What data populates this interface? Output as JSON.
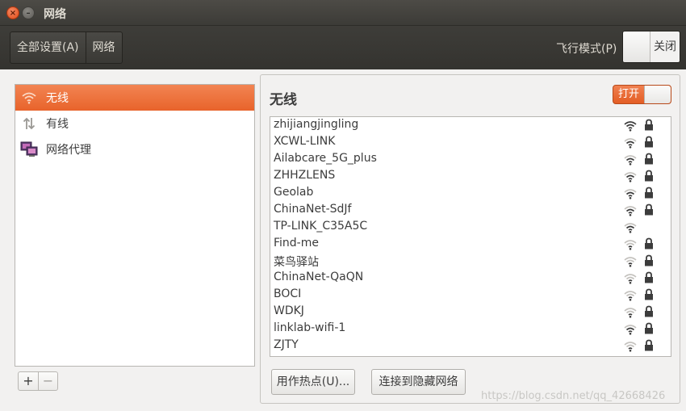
{
  "window": {
    "title": "网络"
  },
  "toolbar": {
    "crumbs": [
      "全部设置(A)",
      "网络"
    ],
    "airplane_label": "飞行模式(P)",
    "airplane_state": "关闭"
  },
  "devices": [
    {
      "label": "无线",
      "icon": "wifi-icon",
      "selected": true
    },
    {
      "label": "有线",
      "icon": "wired-arrows-icon",
      "selected": false
    },
    {
      "label": "网络代理",
      "icon": "proxy-monitor-icon",
      "selected": false
    }
  ],
  "list_tools": {
    "add": "+",
    "remove": "−"
  },
  "wireless": {
    "title": "无线",
    "switch_label": "打开",
    "networks": [
      {
        "name": "zhijiangjingling",
        "secured": true,
        "strength": 4
      },
      {
        "name": "XCWL-LINK",
        "secured": true,
        "strength": 3
      },
      {
        "name": "Ailabcare_5G_plus",
        "secured": true,
        "strength": 3
      },
      {
        "name": "ZHHZLENS",
        "secured": true,
        "strength": 3
      },
      {
        "name": "Geolab",
        "secured": true,
        "strength": 3
      },
      {
        "name": "ChinaNet-SdJf",
        "secured": true,
        "strength": 3
      },
      {
        "name": "TP-LINK_C35A5C",
        "secured": false,
        "strength": 3
      },
      {
        "name": "Find-me",
        "secured": true,
        "strength": 2
      },
      {
        "name": "菜鸟驿站",
        "secured": true,
        "strength": 2
      },
      {
        "name": "ChinaNet-QaQN",
        "secured": true,
        "strength": 2
      },
      {
        "name": "BOCI",
        "secured": true,
        "strength": 2
      },
      {
        "name": "WDKJ",
        "secured": true,
        "strength": 2
      },
      {
        "name": "linklab-wifi-1",
        "secured": true,
        "strength": 3
      },
      {
        "name": "ZJTY",
        "secured": true,
        "strength": 2
      }
    ],
    "hotspot_button": "用作热点(U)...",
    "hidden_button": "连接到隐藏网络"
  },
  "watermark": "https://blog.csdn.net/qq_42668426",
  "colors": {
    "accent": "#e8632b",
    "titlebar": "#3c3b37"
  }
}
